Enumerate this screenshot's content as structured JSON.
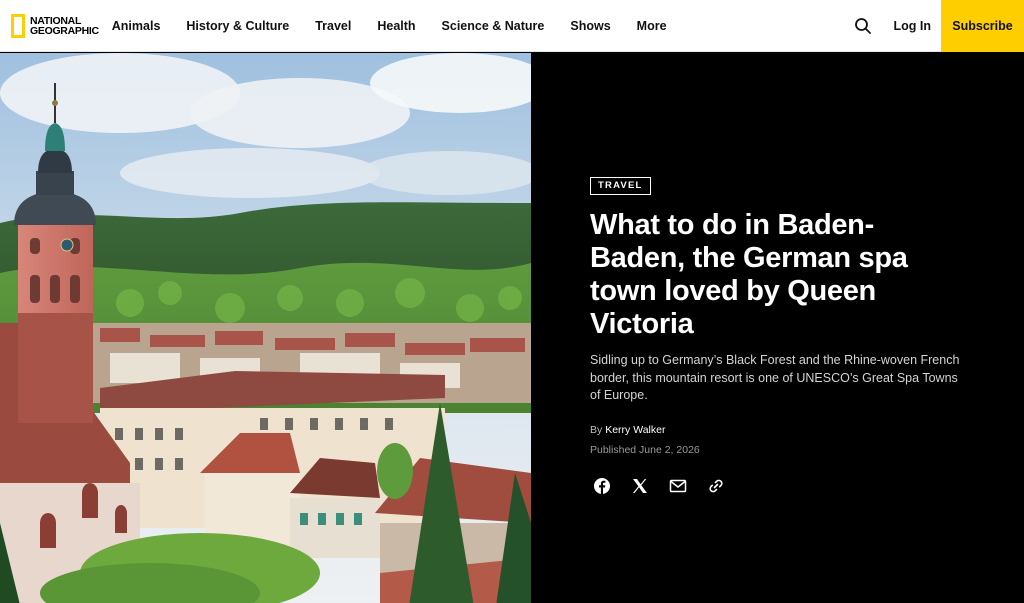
{
  "header": {
    "logo": {
      "line1": "NATIONAL",
      "line2": "GEOGRAPHIC"
    },
    "nav": [
      "Animals",
      "History & Culture",
      "Travel",
      "Health",
      "Science & Nature",
      "Shows",
      "More"
    ],
    "search_icon": "search-icon",
    "login_label": "Log In",
    "subscribe_label": "Subscribe",
    "accent_color": "#ffce00"
  },
  "article": {
    "tag": "TRAVEL",
    "headline": "What to do in Baden-Baden, the German spa town loved by Queen Victoria",
    "dek": "Sidling up to Germany’s Black Forest and the Rhine-woven French border, this mountain resort is one of UNESCO’s Great Spa Towns of Europe.",
    "byline_prefix": "By",
    "author": "Kerry Walker",
    "published": "Published June 2, 2026",
    "share_icons": [
      "facebook-icon",
      "x-icon",
      "email-icon",
      "link-icon"
    ]
  }
}
